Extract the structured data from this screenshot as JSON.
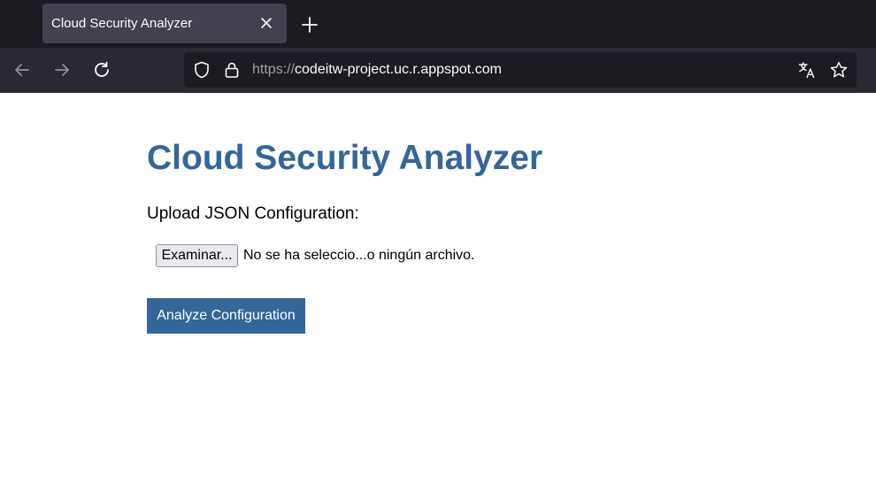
{
  "browser": {
    "tab": {
      "title": "Cloud Security Analyzer"
    },
    "address_bar": {
      "scheme": "https://",
      "host": "codeitw-project.uc.r.appspot.com"
    },
    "icons": {
      "back": "arrow-left-icon",
      "forward": "arrow-right-icon",
      "reload": "reload-icon",
      "tracking_protection": "shield-icon",
      "site_security": "lock-icon",
      "translate": "translate-icon",
      "bookmark": "star-icon",
      "tab_close": "close-icon",
      "new_tab": "plus-icon"
    }
  },
  "page": {
    "title": "Cloud Security Analyzer",
    "upload_label": "Upload JSON Configuration:",
    "file_input": {
      "button_label": "Examinar...",
      "status": "No se ha seleccio...o ningún archivo."
    },
    "analyze_button": "Analyze Configuration"
  },
  "colors": {
    "accent": "#336699",
    "chrome_dark": "#1c1b22",
    "chrome_toolbar": "#2b2a33",
    "tab_active": "#42414d"
  }
}
